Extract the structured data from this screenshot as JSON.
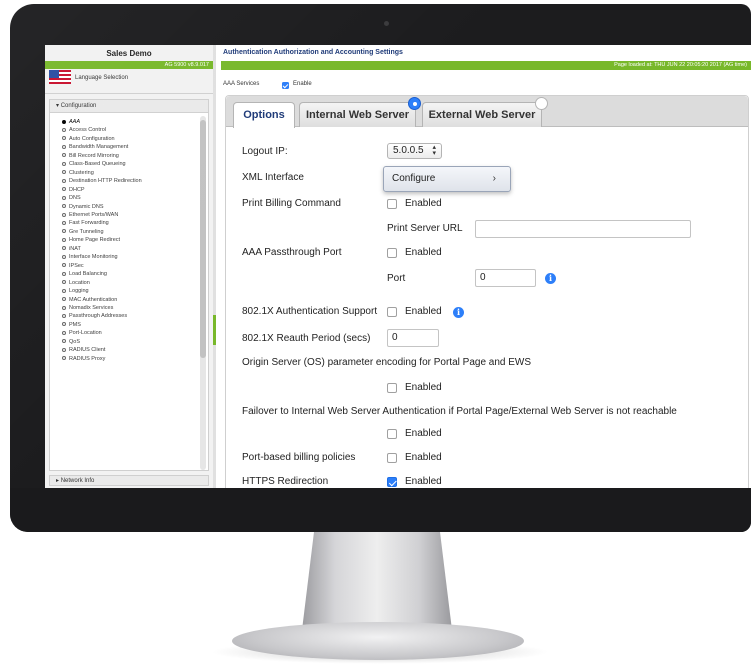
{
  "sidebar": {
    "title": "Sales Demo",
    "version": "AG 5900 v8.9.017",
    "language_label": "Language Selection",
    "config_header": "Configuration",
    "items": [
      {
        "label": "AAA",
        "active": true
      },
      {
        "label": "Access Control"
      },
      {
        "label": "Auto Configuration"
      },
      {
        "label": "Bandwidth Management"
      },
      {
        "label": "Bill Record Mirroring"
      },
      {
        "label": "Class-Based Queueing"
      },
      {
        "label": "Clustering"
      },
      {
        "label": "Destination HTTP Redirection"
      },
      {
        "label": "DHCP"
      },
      {
        "label": "DNS"
      },
      {
        "label": "Dynamic DNS"
      },
      {
        "label": "Ethernet Ports/WAN"
      },
      {
        "label": "Fast Forwarding"
      },
      {
        "label": "Gre Tunneling"
      },
      {
        "label": "Home Page Redirect"
      },
      {
        "label": "iNAT"
      },
      {
        "label": "Interface Monitoring"
      },
      {
        "label": "IPSec"
      },
      {
        "label": "Load Balancing"
      },
      {
        "label": "Location"
      },
      {
        "label": "Logging"
      },
      {
        "label": "MAC Authentication"
      },
      {
        "label": "Nomadix Services"
      },
      {
        "label": "Passthrough Addresses"
      },
      {
        "label": "PMS"
      },
      {
        "label": "Port-Location"
      },
      {
        "label": "QoS"
      },
      {
        "label": "RADIUS Client"
      },
      {
        "label": "RADIUS Proxy"
      }
    ],
    "network_info": "Network Info"
  },
  "header": {
    "title": "Authentication Authorization and Accounting Settings",
    "page_loaded": "Page loaded at:  THU JUN 22 20:05:20 2017  (AG time)",
    "aaa_services_label": "AAA Services",
    "enable_label": "Enable"
  },
  "tabs": [
    {
      "label": "Options",
      "active": true
    },
    {
      "label": "Internal Web Server",
      "radio": "selected"
    },
    {
      "label": "External Web Server",
      "radio": "unselected"
    }
  ],
  "form": {
    "logout_ip_label": "Logout IP:",
    "logout_ip_value": "5.0.0.5",
    "xml_interface_label": "XML Interface",
    "configure_label": "Configure",
    "configure_chevron": "›",
    "print_billing_label": "Print Billing Command",
    "print_billing_enabled": "Enabled",
    "print_server_url_label": "Print Server URL",
    "print_server_url_value": "",
    "aaa_passthrough_label": "AAA Passthrough Port",
    "aaa_passthrough_enabled": "Enabled",
    "port_label": "Port",
    "port_value": "0",
    "dot1x_label": "802.1X Authentication Support",
    "dot1x_enabled": "Enabled",
    "reauth_label": "802.1X Reauth Period (secs)",
    "reauth_value": "0",
    "origin_label": "Origin Server (OS) parameter encoding for Portal Page and EWS",
    "origin_enabled": "Enabled",
    "failover_label": "Failover to Internal Web Server Authentication if Portal Page/External Web Server is not reachable",
    "failover_enabled": "Enabled",
    "port_billing_label": "Port-based billing policies",
    "port_billing_enabled": "Enabled",
    "https_label": "HTTPS Redirection",
    "https_enabled": "Enabled",
    "info_glyph": "i"
  },
  "colors": {
    "accent_green": "#78b82a",
    "accent_blue": "#2d7ff9",
    "title_blue": "#1e3a78"
  }
}
